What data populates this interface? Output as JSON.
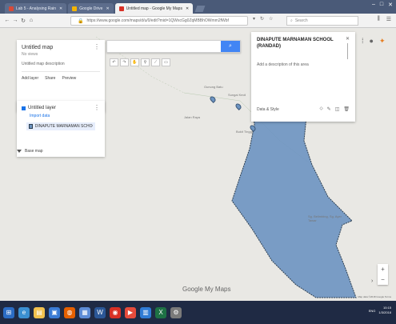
{
  "browser": {
    "tabs": [
      {
        "label": "Lab 5 - Analysing Rain",
        "active": false,
        "favicon_color": "#d84a38"
      },
      {
        "label": "Google Drive",
        "active": false,
        "favicon_color": "#f4b400"
      },
      {
        "label": "Untitled map - Google My Maps",
        "active": true,
        "favicon_color": "#d93025"
      }
    ],
    "address": "https://www.google.com/maps/d/u/0/edit?mid=1QWxcGg0ZqMBBhOWmm2fWbf",
    "search_placeholder": "Search"
  },
  "map": {
    "search_placeholder": "",
    "search_button_icon": "search-icon",
    "tools": [
      "undo-icon",
      "redo-icon",
      "hand-icon",
      "marker-icon",
      "line-icon",
      "ruler-icon"
    ],
    "fill_color": "#6d94c1",
    "stroke_color": "#2c3e50",
    "terrain_labels": [
      "Gunung Batu",
      "Sungai Kecil",
      "Bukit Tinggi",
      "Jalan Raya",
      "Sg. Belimbing, Sg. Ayer Tawar"
    ],
    "logo": "Google My Maps",
    "copyright": "Map data ©2018 Google Terms"
  },
  "panel": {
    "title": "Untitled map",
    "subtitle": "No views",
    "description": "Untitled map description",
    "actions": [
      "Add layer",
      "Share",
      "Preview"
    ],
    "layer_title": "Untitled layer",
    "import_link": "Import data",
    "layer_item": "DINAPUTE MARNAMAN SCHOOL (RANDAD)",
    "basemap": "Base map"
  },
  "card": {
    "title": "DINAPUTE MARNAMAN SCHOOL (RANDAD)",
    "description": "Add a description of this area",
    "footer_left": "Data & Style",
    "icons": [
      "paint-bucket-icon",
      "edit-icon",
      "camera-icon",
      "trash-icon"
    ]
  },
  "taskbar": {
    "apps": [
      {
        "icon": "windows-icon",
        "color": "#2b6cc4"
      },
      {
        "icon": "ie-icon",
        "color": "#3b8fd1"
      },
      {
        "icon": "explorer-icon",
        "color": "#f2c14e"
      },
      {
        "icon": "store-icon",
        "color": "#3a7bd5"
      },
      {
        "icon": "firefox-icon",
        "color": "#e66000"
      },
      {
        "icon": "photos-icon",
        "color": "#5c8bd6"
      },
      {
        "icon": "word-icon",
        "color": "#2b5797"
      },
      {
        "icon": "chrome-icon",
        "color": "#d93025"
      },
      {
        "icon": "media-icon",
        "color": "#e74c3c"
      },
      {
        "icon": "files-icon",
        "color": "#2f7bd5"
      },
      {
        "icon": "excel-icon",
        "color": "#1e7145"
      },
      {
        "icon": "settings-icon",
        "color": "#7a7a7a"
      }
    ],
    "time": "10:15",
    "date": "1/3/2018",
    "lang": "ENG"
  }
}
